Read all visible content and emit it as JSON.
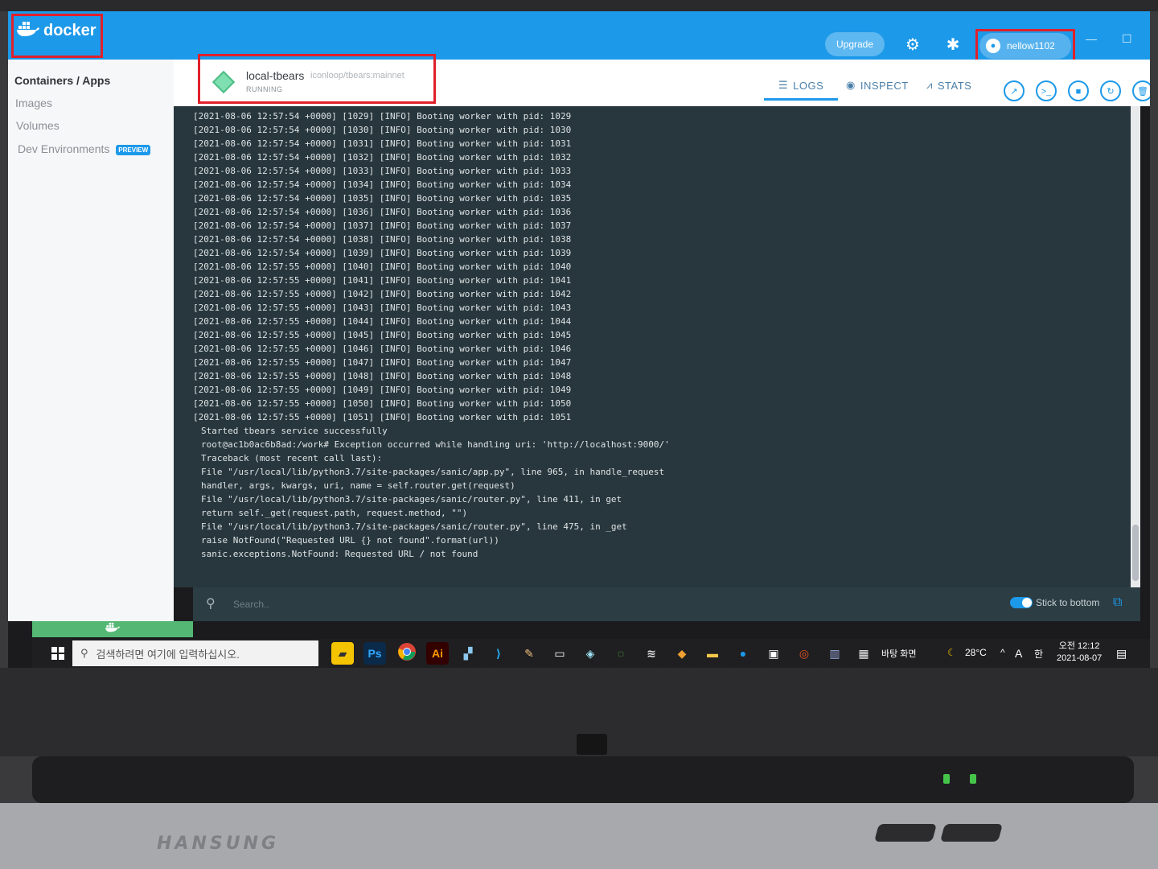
{
  "app": {
    "logo_text": "docker",
    "upgrade_label": "Upgrade",
    "username": "nellow1102"
  },
  "sidebar": {
    "items": [
      {
        "label": "Containers / Apps"
      },
      {
        "label": "Images"
      },
      {
        "label": "Volumes"
      },
      {
        "label": "Dev Environments",
        "badge": "PREVIEW"
      }
    ]
  },
  "container": {
    "name": "local-tbears",
    "image": "iconloop/tbears:mainnet",
    "status": "RUNNING"
  },
  "tabs": [
    {
      "label": "LOGS"
    },
    {
      "label": "INSPECT"
    },
    {
      "label": "STATS"
    }
  ],
  "logs": [
    "[2021-08-06 12:57:54 +0000] [1029] [INFO] Booting worker with pid: 1029",
    "[2021-08-06 12:57:54 +0000] [1030] [INFO] Booting worker with pid: 1030",
    "[2021-08-06 12:57:54 +0000] [1031] [INFO] Booting worker with pid: 1031",
    "[2021-08-06 12:57:54 +0000] [1032] [INFO] Booting worker with pid: 1032",
    "[2021-08-06 12:57:54 +0000] [1033] [INFO] Booting worker with pid: 1033",
    "[2021-08-06 12:57:54 +0000] [1034] [INFO] Booting worker with pid: 1034",
    "[2021-08-06 12:57:54 +0000] [1035] [INFO] Booting worker with pid: 1035",
    "[2021-08-06 12:57:54 +0000] [1036] [INFO] Booting worker with pid: 1036",
    "[2021-08-06 12:57:54 +0000] [1037] [INFO] Booting worker with pid: 1037",
    "[2021-08-06 12:57:54 +0000] [1038] [INFO] Booting worker with pid: 1038",
    "[2021-08-06 12:57:54 +0000] [1039] [INFO] Booting worker with pid: 1039",
    "[2021-08-06 12:57:55 +0000] [1040] [INFO] Booting worker with pid: 1040",
    "[2021-08-06 12:57:55 +0000] [1041] [INFO] Booting worker with pid: 1041",
    "[2021-08-06 12:57:55 +0000] [1042] [INFO] Booting worker with pid: 1042",
    "[2021-08-06 12:57:55 +0000] [1043] [INFO] Booting worker with pid: 1043",
    "[2021-08-06 12:57:55 +0000] [1044] [INFO] Booting worker with pid: 1044",
    "[2021-08-06 12:57:55 +0000] [1045] [INFO] Booting worker with pid: 1045",
    "[2021-08-06 12:57:55 +0000] [1046] [INFO] Booting worker with pid: 1046",
    "[2021-08-06 12:57:55 +0000] [1047] [INFO] Booting worker with pid: 1047",
    "[2021-08-06 12:57:55 +0000] [1048] [INFO] Booting worker with pid: 1048",
    "[2021-08-06 12:57:55 +0000] [1049] [INFO] Booting worker with pid: 1049",
    "[2021-08-06 12:57:55 +0000] [1050] [INFO] Booting worker with pid: 1050",
    "[2021-08-06 12:57:55 +0000] [1051] [INFO] Booting worker with pid: 1051",
    "Started tbears service successfully",
    "root@ac1b0ac6b8ad:/work# Exception occurred while handling uri: 'http://localhost:9000/'",
    "Traceback (most recent call last):",
    "File \"/usr/local/lib/python3.7/site-packages/sanic/app.py\", line 965, in handle_request",
    "handler, args, kwargs, uri, name = self.router.get(request)",
    "File \"/usr/local/lib/python3.7/site-packages/sanic/router.py\", line 411, in get",
    "return self._get(request.path, request.method, \"\")",
    "File \"/usr/local/lib/python3.7/site-packages/sanic/router.py\", line 475, in _get",
    "raise NotFound(\"Requested URL {} not found\".format(url))",
    "sanic.exceptions.NotFound: Requested URL / not found"
  ],
  "search": {
    "placeholder": "Search..",
    "stick_label": "Stick to bottom",
    "stick_enabled": true
  },
  "taskbar": {
    "search_placeholder": "검색하려면 여기에 입력하십시오.",
    "desktop_label": "바탕 화면",
    "temperature": "28°C",
    "ime": "A",
    "ime2": "한",
    "time": "오전 12:12",
    "date": "2021-08-07",
    "apps": [
      "Ps",
      "Ai"
    ]
  },
  "laptop": {
    "brand": "HANSUNG"
  },
  "colors": {
    "docker_blue": "#1d99e9",
    "log_bg": "#27373d",
    "highlight_red": "#e0202a"
  }
}
